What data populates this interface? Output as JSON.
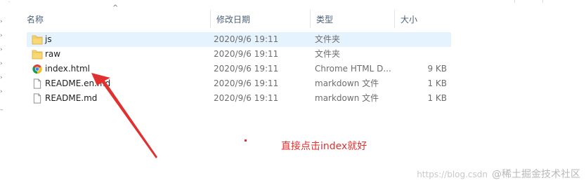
{
  "columns": {
    "name": "名称",
    "date": "修改日期",
    "type": "类型",
    "size": "大小"
  },
  "files": [
    {
      "name": "js",
      "date": "2020/9/6 19:11",
      "type": "文件夹",
      "size": "",
      "icon": "folder-icon",
      "selected": true
    },
    {
      "name": "raw",
      "date": "2020/9/6 19:11",
      "type": "文件夹",
      "size": "",
      "icon": "folder-icon",
      "selected": false
    },
    {
      "name": "index.html",
      "date": "2020/9/6 19:11",
      "type": "Chrome HTML D...",
      "size": "9 KB",
      "icon": "chrome-icon",
      "selected": false
    },
    {
      "name": "README.en.md",
      "date": "2020/9/6 19:11",
      "type": "markdown 文件",
      "size": "1 KB",
      "icon": "file-icon",
      "selected": false
    },
    {
      "name": "README.md",
      "date": "2020/9/6 19:11",
      "type": "markdown 文件",
      "size": "1 KB",
      "icon": "file-icon",
      "selected": false
    }
  ],
  "annotation": {
    "text": "直接点击index就好",
    "color": "#e03030"
  },
  "watermark": {
    "url": "https://blog.csdn",
    "text": "@稀土掘金技术社区"
  },
  "colors": {
    "selected_row": "#e5f3ff",
    "folder": "#f8d775",
    "header_text": "#4c607a"
  }
}
